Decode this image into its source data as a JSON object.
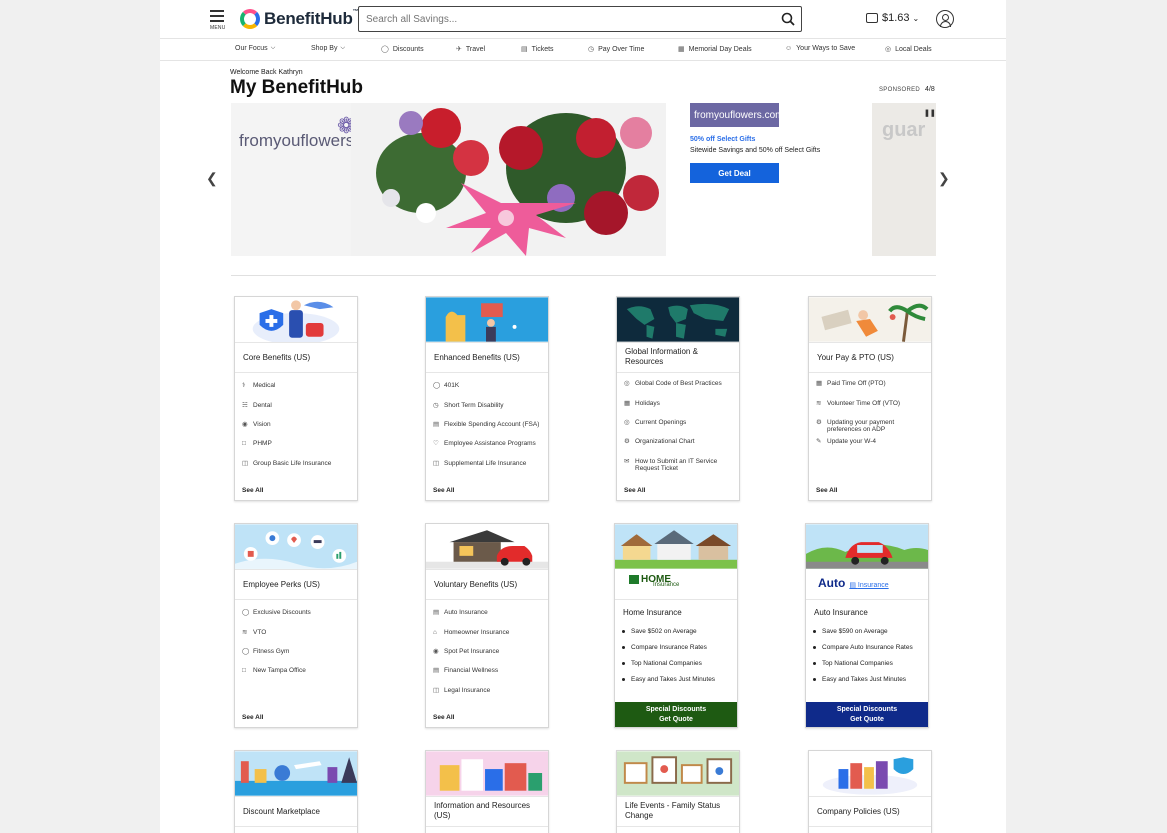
{
  "header": {
    "menu_label": "MENU",
    "brand": "BenefitHub",
    "brand_mark": "™",
    "search_placeholder": "Search all Savings...",
    "wallet_amount": "$1.63"
  },
  "nav": [
    {
      "label": "Our Focus",
      "icon": "chevron-down-icon"
    },
    {
      "label": "Shop By",
      "icon": "chevron-down-icon"
    },
    {
      "label": "Discounts",
      "icon": "tag-icon"
    },
    {
      "label": "Travel",
      "icon": "plane-icon"
    },
    {
      "label": "Tickets",
      "icon": "ticket-icon"
    },
    {
      "label": "Pay Over Time",
      "icon": "clock-icon"
    },
    {
      "label": "Memorial Day Deals",
      "icon": "gift-icon"
    },
    {
      "label": "Your Ways to Save",
      "icon": "person-icon"
    },
    {
      "label": "Local Deals",
      "icon": "pin-icon"
    }
  ],
  "welcome": "Welcome Back Kathryn",
  "title": "My BenefitHub",
  "sponsored": "SPONSORED",
  "counter": "4/8",
  "promo": {
    "banner_brand": "fromyouflowers.com",
    "logo_text": "fromyouflowers.com",
    "headline": "50% off Select Gifts",
    "subline": "Sitewide Savings and 50% off Select Gifts",
    "button": "Get Deal",
    "next_slide_text": "guar"
  },
  "cards": [
    {
      "title": "Core Benefits (US)",
      "links": [
        "Medical",
        "Dental",
        "Vision",
        "PHMP",
        "Group Basic Life Insurance"
      ],
      "see_all": "See All"
    },
    {
      "title": "Enhanced Benefits (US)",
      "links": [
        "401K",
        "Short Term Disability",
        "Flexible Spending Account (FSA)",
        "Employee Assistance Programs",
        "Supplemental Life Insurance"
      ],
      "see_all": "See All"
    },
    {
      "title": "Global Information & Resources",
      "links": [
        "Global Code of Best Practices",
        "Holidays",
        "Current Openings",
        "Organizational Chart",
        "How to Submit an IT Service Request Ticket"
      ],
      "see_all": "See All"
    },
    {
      "title": "Your Pay & PTO (US)",
      "links": [
        "Paid Time Off (PTO)",
        "Volunteer Time Off (VTO)",
        "Updating your payment preferences on ADP",
        "Update your W-4"
      ],
      "see_all": "See All"
    },
    {
      "title": "Employee Perks (US)",
      "links": [
        "Exclusive Discounts",
        "VTO",
        "Fitness Gym",
        "New Tampa Office"
      ],
      "see_all": "See All"
    },
    {
      "title": "Voluntary Benefits (US)",
      "links": [
        "Auto Insurance",
        "Homeowner Insurance",
        "Spot Pet Insurance",
        "Financial Wellness",
        "Legal Insurance"
      ],
      "see_all": "See All"
    },
    {
      "title": "Home Insurance",
      "logo_main": "HOME",
      "logo_sub": "Insurance",
      "bullets": [
        "Save $502 on Average",
        "Compare Insurance Rates",
        "Top National Companies",
        "Easy and Takes Just Minutes"
      ],
      "cta_line1": "Special Discounts",
      "cta_line2": "Get Quote",
      "cta_color": "#1e5a12"
    },
    {
      "title": "Auto Insurance",
      "logo_main": "Auto",
      "logo_sub": "Insurance",
      "bullets": [
        "Save $590 on Average",
        "Compare Auto Insurance Rates",
        "Top National Companies",
        "Easy and Takes Just Minutes"
      ],
      "cta_line1": "Special Discounts",
      "cta_line2": "Get Quote",
      "cta_color": "#0f2a8a"
    },
    {
      "title": "Discount Marketplace"
    },
    {
      "title": "Information and Resources (US)"
    },
    {
      "title": "Life Events - Family Status Change"
    },
    {
      "title": "Company Policies (US)"
    }
  ]
}
